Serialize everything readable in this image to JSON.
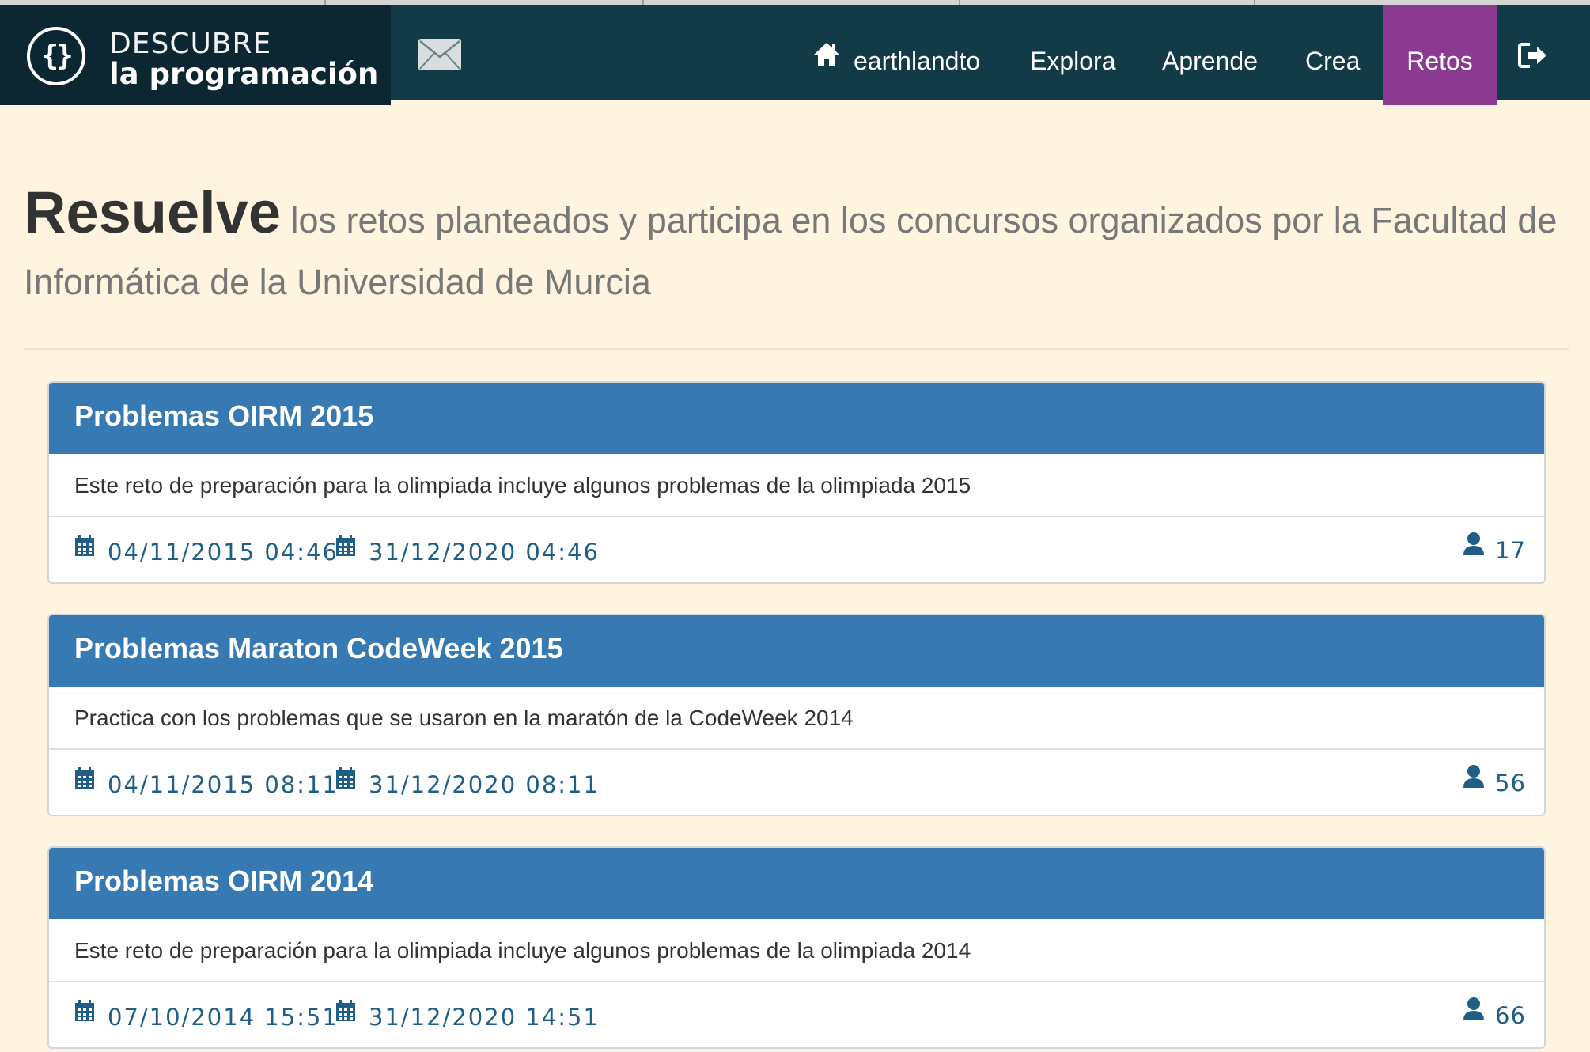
{
  "brand": {
    "line1": "DESCUBRE",
    "line2": "la programación",
    "logo_glyph": "{}"
  },
  "nav": {
    "mail_icon": "envelope-icon",
    "user_label": "earthlandto",
    "explora": "Explora",
    "aprende": "Aprende",
    "crea": "Crea",
    "retos": "Retos",
    "logout_icon": "logout-icon",
    "active_color": "#8b3a92"
  },
  "headline": {
    "strong": "Resuelve",
    "rest": "los retos planteados y participa en los concursos organizados por la Facultad de Informática de la Universidad de Murcia"
  },
  "colors": {
    "page_bg": "#fef4df",
    "navbar": "#133a47",
    "card_header": "#3779b3",
    "meta_text": "#1f5e86"
  },
  "challenges": [
    {
      "title": "Problemas OIRM 2015",
      "description": "Este reto de preparación para la olimpiada incluye algunos problemas de la olimpiada 2015",
      "start": "04/11/2015 04:46",
      "end": "31/12/2020 04:46",
      "participants": "17"
    },
    {
      "title": "Problemas Maraton CodeWeek 2015",
      "description": "Practica con los problemas que se usaron en la maratón de la CodeWeek 2014",
      "start": "04/11/2015 08:11",
      "end": "31/12/2020 08:11",
      "participants": "56"
    },
    {
      "title": "Problemas OIRM 2014",
      "description": "Este reto de preparación para la olimpiada incluye algunos problemas de la olimpiada 2014",
      "start": "07/10/2014 15:51",
      "end": "31/12/2020 14:51",
      "participants": "66"
    }
  ]
}
